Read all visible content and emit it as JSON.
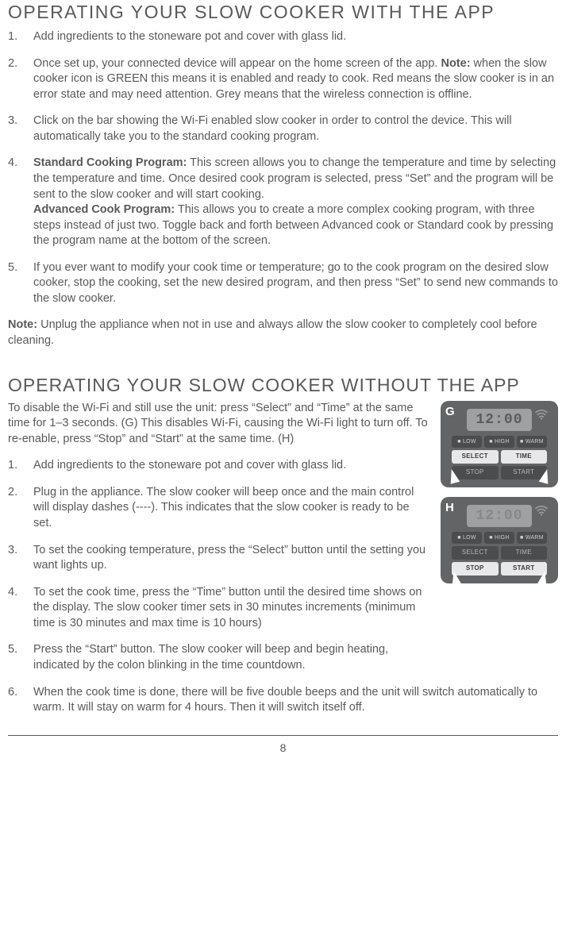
{
  "headings": {
    "with_app": "OPERATING YOUR SLOW COOKER WITH THE APP",
    "without_app": "OPERATING YOUR SLOW COOKER WITHOUT THE APP"
  },
  "with_app": {
    "items": [
      {
        "text": "Add ingredients to the stoneware pot and cover with glass lid."
      },
      {
        "prefix_bold": "Note:",
        "lead": "Once set up, your connected device will appear on the home screen of the app. ",
        "rest": " when the slow cooker icon is GREEN this means it is enabled and ready to cook. Red means the slow cooker is in an error state and may need attention. Grey means that the wireless connection is offline."
      },
      {
        "text": "Click on the bar showing the Wi-Fi enabled slow cooker in order to control the device. This will automatically take you to the standard cooking program."
      },
      {
        "bold1": "Standard Cooking Program:",
        "text1": " This screen allows you to change the temperature and time by selecting the temperature and time. Once desired cook program is selected, press “Set” and the program will be sent to the slow cooker and will start cooking.",
        "bold2": "Advanced Cook Program:",
        "text2": " This allows you to create a more complex cooking program, with three steps instead of just two. Toggle back and forth between Advanced cook or Standard cook by pressing the program name at the bottom of the screen."
      },
      {
        "text": "If you ever want to modify your cook time or temperature; go to the cook program on the desired slow cooker, stop the cooking, set the new desired program, and then press “Set” to send new commands to the slow cooker."
      }
    ],
    "note_bold": "Note:",
    "note_rest": " Unplug the appliance when not in use and always allow the slow cooker to completely cool before cleaning."
  },
  "without_app": {
    "intro": "To disable the Wi-Fi and still use the unit: press “Select” and “Time” at the same time for 1–3 seconds. (G) This disables Wi-Fi, causing the Wi-Fi light to turn off. To re-enable, press “Stop” and “Start” at the same time. (H)",
    "items": [
      "Add ingredients to the stoneware pot and cover with glass lid.",
      "Plug in the appliance. The slow cooker will beep once and the main control will display dashes (----). This indicates that the slow cooker is ready to be set.",
      "To set the cooking temperature, press the “Select” button until the setting you want lights up.",
      "To set the cook time, press the “Time” button until the desired time shows on the display. The slow cooker timer sets in 30 minutes increments (minimum time is 30 minutes and max time is 10 hours)",
      "Press the “Start” button. The slow cooker will beep and begin heating, indicated by the colon blinking in the time countdown.",
      "When the cook time is done, there will be five double beeps and the unit will switch automatically to warm. It will stay on warm for 4 hours. Then it will switch itself off."
    ]
  },
  "panels": {
    "g": {
      "label": "G",
      "display": "12:00",
      "indicators": [
        "■ LOW",
        "■ HIGH",
        "■ WARM"
      ],
      "row2_left": "SELECT",
      "row2_right": "TIME",
      "row3_left": "STOP",
      "row3_right": "START",
      "row2_left_active": true,
      "row2_right_active": true,
      "row3_left_active": false,
      "row3_right_active": false
    },
    "h": {
      "label": "H",
      "display": "12:00",
      "indicators": [
        "■ LOW",
        "■ HIGH",
        "■ WARM"
      ],
      "row2_left": "SELECT",
      "row2_right": "TIME",
      "row3_left": "STOP",
      "row3_right": "START",
      "row2_left_active": false,
      "row2_right_active": false,
      "row3_left_active": true,
      "row3_right_active": true
    }
  },
  "page_number": "8"
}
